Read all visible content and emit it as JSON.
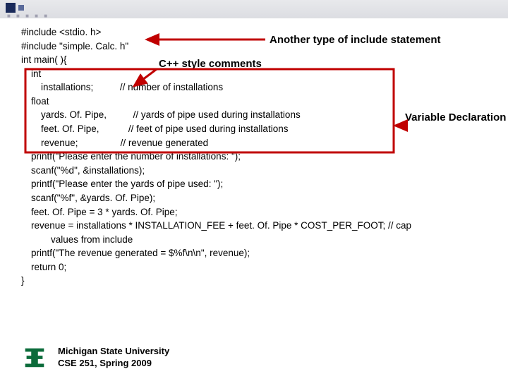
{
  "labels": {
    "include": "Another type of include statement",
    "comments": "C++ style comments",
    "vardecl": "Variable\nDeclaration"
  },
  "code": {
    "l1": "#include <stdio. h>",
    "l2": "#include \"simple. Calc. h\"",
    "l3": "int main( ){",
    "l4": "int",
    "l5": "installations;",
    "l5c": "// number of installations",
    "l6": "float",
    "l7": "yards. Of. Pipe,",
    "l7c": "// yards of pipe used during installations",
    "l8": "feet. Of. Pipe,",
    "l8c": "// feet of pipe used during installations",
    "l9": "revenue;",
    "l9c": "// revenue generated",
    "l10": "printf(\"Please enter the number of installations: \");",
    "l11": "scanf(\"%d\", &installations);",
    "l12": "printf(\"Please enter the yards of pipe used: \");",
    "l13": "scanf(\"%f\", &yards. Of. Pipe);",
    "l14": "feet. Of. Pipe = 3 * yards. Of. Pipe;",
    "l15": "revenue = installations * INSTALLATION_FEE + feet. Of. Pipe * COST_PER_FOOT; // cap",
    "l15b": "values from include",
    "l16": "printf(\"The revenue generated = $%f\\n\\n\", revenue);",
    "l17": "return 0;",
    "l18": "}"
  },
  "footer": {
    "line1": "Michigan State University",
    "line2": "CSE 251, Spring 2009"
  }
}
